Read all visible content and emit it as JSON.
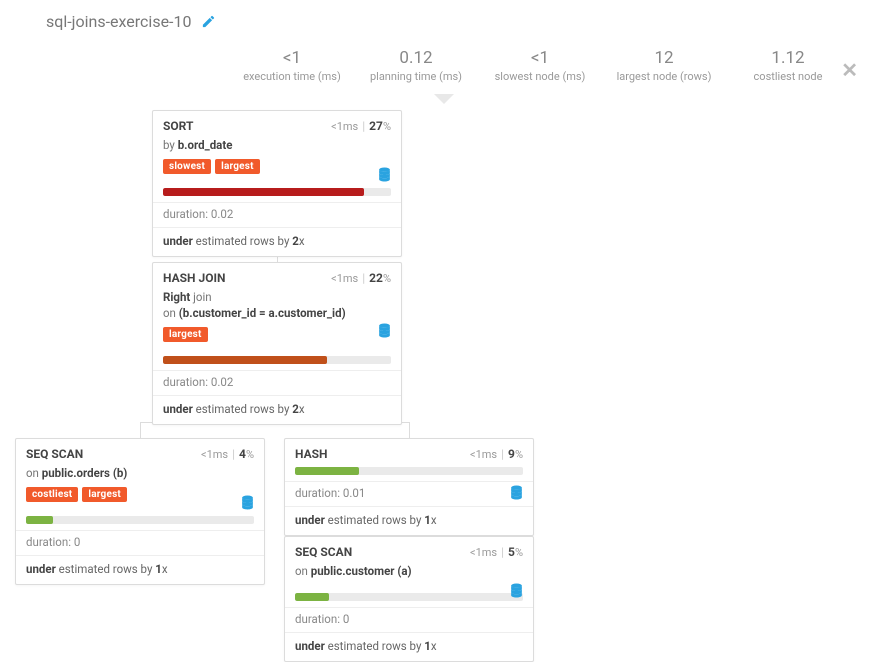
{
  "title": "sql-joins-exercise-10",
  "stats": [
    {
      "value": "<1",
      "label": "execution time (ms)"
    },
    {
      "value": "0.12",
      "label": "planning time (ms)"
    },
    {
      "value": "<1",
      "label": "slowest node (ms)"
    },
    {
      "value": "12",
      "label": "largest node (rows)"
    },
    {
      "value": "1.12",
      "label": "costliest node"
    }
  ],
  "nodes": {
    "sort": {
      "name": "SORT",
      "time": "<1ms",
      "pct": "27",
      "desc_prefix": "by ",
      "desc_bold": "b.ord_date",
      "tags": [
        "slowest",
        "largest"
      ],
      "bar_color": "#b71c1c",
      "bar_width": "88%",
      "duration_label": "duration:",
      "duration_value": "0.02",
      "est_prefix": "under",
      "est_mid": " estimated rows by ",
      "est_x": "2",
      "est_suffix": "x"
    },
    "hashjoin": {
      "name": "HASH JOIN",
      "time": "<1ms",
      "pct": "22",
      "desc1_bold": "Right",
      "desc1_rest": " join",
      "desc2_prefix": "on ",
      "desc2_bold": "(b.customer_id = a.customer_id)",
      "tags": [
        "largest"
      ],
      "bar_color": "#c0501a",
      "bar_width": "72%",
      "duration_label": "duration:",
      "duration_value": "0.02",
      "est_prefix": "under",
      "est_mid": " estimated rows by ",
      "est_x": "2",
      "est_suffix": "x"
    },
    "seqscan_orders": {
      "name": "SEQ SCAN",
      "time": "<1ms",
      "pct": "4",
      "desc_prefix": "on ",
      "desc_bold": "public.orders (b)",
      "tags": [
        "costliest",
        "largest"
      ],
      "bar_color": "#7cb342",
      "bar_width": "12%",
      "duration_label": "duration:",
      "duration_value": "0",
      "est_prefix": "under",
      "est_mid": " estimated rows by ",
      "est_x": "1",
      "est_suffix": "x"
    },
    "hash": {
      "name": "HASH",
      "time": "<1ms",
      "pct": "9",
      "bar_color": "#7cb342",
      "bar_width": "28%",
      "duration_label": "duration:",
      "duration_value": "0.01",
      "est_prefix": "under",
      "est_mid": " estimated rows by ",
      "est_x": "1",
      "est_suffix": "x"
    },
    "seqscan_customer": {
      "name": "SEQ SCAN",
      "time": "<1ms",
      "pct": "5",
      "desc_prefix": "on ",
      "desc_bold": "public.customer (a)",
      "bar_color": "#7cb342",
      "bar_width": "15%",
      "duration_label": "duration:",
      "duration_value": "0",
      "est_prefix": "under",
      "est_mid": " estimated rows by ",
      "est_x": "1",
      "est_suffix": "x"
    }
  },
  "pct_unit": " %"
}
